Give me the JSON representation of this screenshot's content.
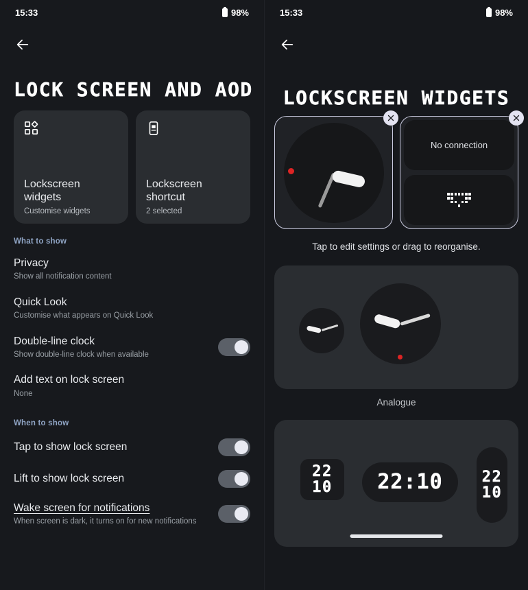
{
  "status_bar": {
    "time": "15:33",
    "battery": "98%",
    "battery_icon": "battery-full-icon"
  },
  "left_panel": {
    "back_icon": "back-arrow-icon",
    "title": "LOCK SCREEN AND AOD",
    "cards": [
      {
        "icon": "widgets-grid-icon",
        "title": "Lockscreen widgets",
        "subtitle": "Customise widgets"
      },
      {
        "icon": "phone-shortcut-icon",
        "title": "Lockscreen shortcut",
        "subtitle": "2 selected"
      }
    ],
    "sections": [
      {
        "header": "What to show",
        "rows": [
          {
            "title": "Privacy",
            "subtitle": "Show all notification content",
            "toggle": null
          },
          {
            "title": "Quick Look",
            "subtitle": "Customise what appears on Quick Look",
            "toggle": null
          },
          {
            "title": "Double-line clock",
            "subtitle": "Show double-line clock when available",
            "toggle": "on"
          },
          {
            "title": "Add text on lock screen",
            "subtitle": "None",
            "toggle": null
          }
        ]
      },
      {
        "header": "When to show",
        "rows": [
          {
            "title": "Tap to show lock screen",
            "subtitle": "",
            "toggle": "on"
          },
          {
            "title": "Lift to show lock screen",
            "subtitle": "",
            "toggle": "on"
          },
          {
            "title": "Wake screen for notifications",
            "subtitle": "When screen is dark, it turns on for new notifications",
            "toggle": "on",
            "underlined": true
          }
        ]
      }
    ]
  },
  "right_panel": {
    "back_icon": "back-arrow-icon",
    "title": "LOCKSCREEN WIDGETS",
    "slots": [
      {
        "type": "analogue-clock",
        "close_icon": "close-icon",
        "selected": true
      },
      {
        "type": "connection-widget",
        "close_icon": "close-icon",
        "label": "No connection",
        "icon": "wifi-pixel-icon",
        "selected": true
      }
    ],
    "hint": "Tap to edit settings or drag to reorganise.",
    "previews": [
      {
        "name": "analogue-preview",
        "label": "Analogue"
      },
      {
        "name": "digital-preview",
        "label": "",
        "times": [
          "22",
          "10",
          "22:10",
          "22",
          "10"
        ]
      }
    ],
    "home_indicator": "home-indicator"
  },
  "colors": {
    "accent_header": "#8fa4c4",
    "toggle_on": "#5b6068",
    "red_dot": "#dd2424",
    "selection_border": "#c9cadf"
  }
}
